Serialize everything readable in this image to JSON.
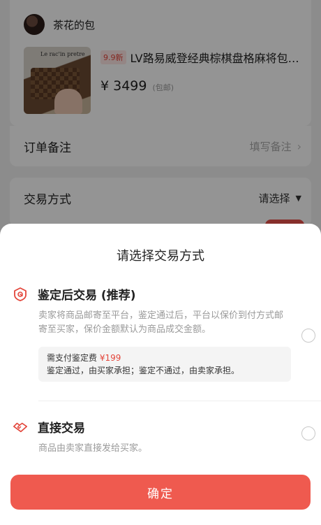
{
  "background_page": {
    "seller_name": "茶花的包",
    "product": {
      "condition_tag": "9.9新",
      "title": "LV路易威登经典棕棋盘格麻将包。…",
      "price": "¥ 3499",
      "shipping": "(包邮)",
      "image_sign_text": "Le rac'in pretre"
    },
    "order_note": {
      "label": "订单备注",
      "placeholder": "填写备注"
    },
    "trade_method": {
      "label": "交易方式",
      "value": "请选择"
    }
  },
  "sheet": {
    "title": "请选择交易方式",
    "options": [
      {
        "name": "鉴定后交易 (推荐)",
        "icon": "shield-icon",
        "description": "卖家将商品邮寄至平台，鉴定通过后，平台以保价到付方式邮寄至买家，保价金额默认为商品成交金额。",
        "fee_label": "需支付鉴定费",
        "fee_amount": "¥199",
        "fee_note": "鉴定通过，由买家承担；鉴定不通过，由卖家承担。",
        "selected": false
      },
      {
        "name": "直接交易",
        "icon": "handshake-icon",
        "description": "商品由卖家直接发给买家。",
        "selected": false
      }
    ],
    "confirm_label": "确定"
  },
  "colors": {
    "accent": "#ef5a4f",
    "price_red": "#e3453a",
    "overlay": "rgba(0,0,0,0.42)"
  }
}
